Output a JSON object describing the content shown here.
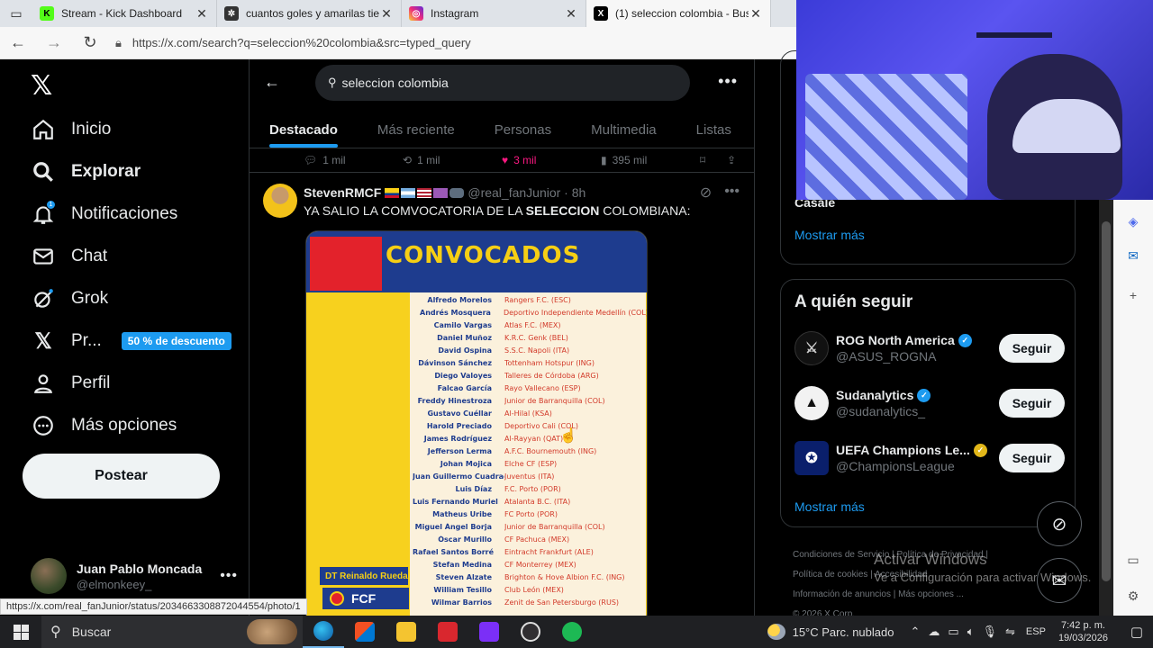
{
  "browser": {
    "tabs": [
      {
        "title": "Stream - Kick Dashboard",
        "icon": "kick-icon",
        "color": "#53fc18",
        "active": false
      },
      {
        "title": "cuantos goles y amarilas tien",
        "icon": "ai-icon",
        "color": "#333333",
        "active": false
      },
      {
        "title": "Instagram",
        "icon": "instagram-icon",
        "color": "#e1306c",
        "active": false
      },
      {
        "title": "(1) seleccion colombia - Busc",
        "icon": "x-icon",
        "color": "#000000",
        "active": true
      }
    ],
    "url": "https://x.com/search?q=seleccion%20colombia&src=typed_query",
    "status_url": "https://x.com/real_fanJunior/status/2034663308872044554/photo/1"
  },
  "leftnav": {
    "items": [
      {
        "label": "Inicio",
        "icon": "home-icon",
        "bold": false
      },
      {
        "label": "Explorar",
        "icon": "search-icon",
        "bold": true
      },
      {
        "label": "Notificaciones",
        "icon": "bell-icon",
        "bold": false,
        "badge": "1"
      },
      {
        "label": "Chat",
        "icon": "mail-icon",
        "bold": false
      },
      {
        "label": "Grok",
        "icon": "grok-icon",
        "bold": false
      },
      {
        "label": "Pr...",
        "icon": "x-premium-icon",
        "bold": false,
        "promo": "50 % de descuento"
      },
      {
        "label": "Perfil",
        "icon": "person-icon",
        "bold": false
      },
      {
        "label": "Más opciones",
        "icon": "more-circle-icon",
        "bold": false
      }
    ],
    "post_label": "Postear",
    "account": {
      "display_name": "Juan Pablo Moncada",
      "handle": "@elmonkeey_"
    }
  },
  "search": {
    "query": "seleccion colombia",
    "tabs": [
      "Destacado",
      "Más reciente",
      "Personas",
      "Multimedia",
      "Listas"
    ],
    "active_tab": 0
  },
  "prev_tweet_actions": {
    "replies": "1 mil",
    "reposts": "1 mil",
    "likes": "3 mil",
    "views": "395 mil"
  },
  "tweet": {
    "name": "StevenRMCF",
    "handle": "@real_fanJunior",
    "time": "8h",
    "text_pre": "YA SALIO LA COMVOCATORIA DE LA ",
    "text_bold": "SELECCION",
    "text_post": " COLOMBIANA:",
    "media": {
      "title": "CONVOCADOS",
      "coach": "DT Reinaldo Rueda",
      "federation": "FCF",
      "players": [
        [
          "Alfredo Morelos",
          "Rangers F.C. (ESC)"
        ],
        [
          "Andrés Mosquera",
          "Deportivo Independiente Medellín (COL)"
        ],
        [
          "Camilo Vargas",
          "Atlas F.C. (MEX)"
        ],
        [
          "Daniel Muñoz",
          "K.R.C. Genk (BEL)"
        ],
        [
          "David Ospina",
          "S.S.C. Napoli (ITA)"
        ],
        [
          "Dávinson Sánchez",
          "Tottenham Hotspur (ING)"
        ],
        [
          "Diego Valoyes",
          "Talleres de Córdoba (ARG)"
        ],
        [
          "Falcao García",
          "Rayo Vallecano (ESP)"
        ],
        [
          "Freddy Hinestroza",
          "Junior de Barranquilla (COL)"
        ],
        [
          "Gustavo Cuéllar",
          "Al-Hilal (KSA)"
        ],
        [
          "Harold Preciado",
          "Deportivo Cali (COL)"
        ],
        [
          "James Rodríguez",
          "Al-Rayyan (QAT)"
        ],
        [
          "Jefferson Lerma",
          "A.F.C. Bournemouth (ING)"
        ],
        [
          "Johan Mojica",
          "Elche CF (ESP)"
        ],
        [
          "Juan Guillermo Cuadrado",
          "Juventus (ITA)"
        ],
        [
          "Luis Díaz",
          "F.C. Porto (POR)"
        ],
        [
          "Luis Fernando Muriel",
          "Atalanta B.C. (ITA)"
        ],
        [
          "Matheus Uribe",
          "FC Porto (POR)"
        ],
        [
          "Miguel Ángel Borja",
          "Junior de Barranquilla (COL)"
        ],
        [
          "Óscar Murillo",
          "CF Pachuca (MEX)"
        ],
        [
          "Rafael Santos Borré",
          "Eintracht Frankfurt (ALE)"
        ],
        [
          "Stefan Medina",
          "CF Monterrey (MEX)"
        ],
        [
          "Steven Alzate",
          "Brighton & Hove Albion F.C. (ING)"
        ],
        [
          "William Tesillo",
          "Club León (MEX)"
        ],
        [
          "Wilmar Barrios",
          "Zenit de San Petersburgo (RUS)"
        ]
      ]
    }
  },
  "right": {
    "trend_tail": "Casale",
    "show_more": "Mostrar más",
    "who_to_follow_title": "A quién seguir",
    "follow_label": "Seguir",
    "suggestions": [
      {
        "name": "ROG North America",
        "handle": "@ASUS_ROGNA",
        "verified": "blue"
      },
      {
        "name": "Sudanalytics",
        "handle": "@sudanalytics_",
        "verified": "blue"
      },
      {
        "name": "UEFA Champions Le...",
        "handle": "@ChampionsLeague",
        "verified": "gold"
      }
    ],
    "show_more_2": "Mostrar más",
    "footer": [
      "Condiciones de Servicio",
      "Política de Privacidad",
      "Política de cookies",
      "Accesibilidad",
      "Información de anuncios",
      "Más opciones ...",
      "© 2026 X Corp."
    ]
  },
  "watermark": {
    "title": "Activar Windows",
    "subtitle": "Ve a Configuración para activar Windows."
  },
  "taskbar": {
    "search_placeholder": "Buscar",
    "weather": "15°C  Parc. nublado",
    "lang": "ESP",
    "time": "7:42 p. m.",
    "date": "19/03/2026"
  }
}
